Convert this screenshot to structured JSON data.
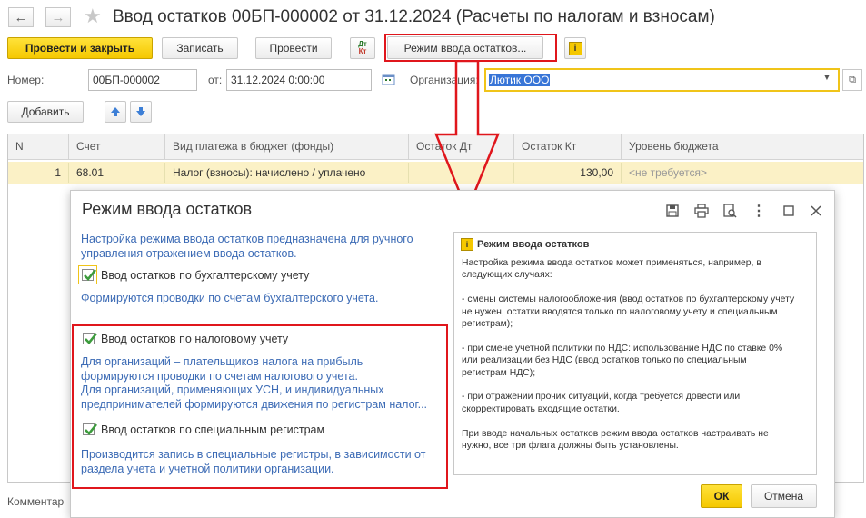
{
  "window": {
    "title": "Ввод остатков 00БП-000002 от 31.12.2024 (Расчеты по налогам и взносам)"
  },
  "toolbar": {
    "post_close_label": "Провести и закрыть",
    "write_label": "Записать",
    "post_label": "Провести",
    "dtkt_label_top": "Дт",
    "dtkt_label_bottom": "Кт",
    "mode_label": "Режим ввода остатков..."
  },
  "form": {
    "number_label": "Номер:",
    "number_value": "00БП-000002",
    "date_label": "от:",
    "date_value": "31.12.2024  0:00:00",
    "org_label": "Организация:",
    "org_value": "Лютик ООО"
  },
  "table_toolbar": {
    "add_label": "Добавить"
  },
  "table": {
    "columns": [
      "N",
      "Счет",
      "Вид платежа в бюджет (фонды)",
      "Остаток Дт",
      "Остаток Кт",
      "Уровень бюджета"
    ],
    "rows": [
      {
        "n": "1",
        "account": "68.01",
        "payment_type": "Налог (взносы): начислено / уплачено",
        "debit": "",
        "credit": "130,00",
        "budget_level": "<не требуется>"
      }
    ]
  },
  "footer": {
    "comment_label": "Комментар"
  },
  "dialog": {
    "title": "Режим ввода остатков",
    "intro": [
      "Настройка режима ввода остатков предназначена для ручного",
      "управления отражением  ввода остатков."
    ],
    "cb_accounting_label": "Ввод остатков по бухгалтерскому учету",
    "cb_accounting_desc": "Формируются проводки по счетам бухгалтерского учета.",
    "cb_tax_label": "Ввод остатков по налоговому учету",
    "cb_tax_desc": [
      "Для организаций – плательщиков налога на прибыль",
      "формируются проводки по счетам налогового учета.",
      "Для организаций, применяющих УСН, и  индивидуальных",
      "предпринимателей формируются движения по регистрам налог..."
    ],
    "cb_special_label": "Ввод остатков по специальным регистрам",
    "cb_special_desc": [
      "Производится запись в специальные регистры, в зависимости от",
      "раздела учета и учетной политики организации."
    ],
    "help": {
      "title": "Режим ввода остатков",
      "lines": [
        "Настройка режима ввода остатков может применяться, например, в",
        "следующих случаях:",
        "",
        "- смены системы налогообложения (ввод остатков по бухгалтерскому учету",
        "не нужен, остатки вводятся только по налоговому учету и специальным",
        "регистрам);",
        "",
        "- при смене учетной политики по НДС: использование НДС по ставке 0%",
        "или реализации без НДС (ввод остатков только по специальным",
        "регистрам НДС);",
        "",
        "- при отражении прочих ситуаций, когда требуется довести или",
        "скорректировать входящие остатки.",
        "",
        "При вводе начальных остатков режим ввода остатков настраивать не",
        "нужно, все три флага должны быть установлены."
      ]
    },
    "ok_label": "ОК",
    "cancel_label": "Отмена"
  },
  "state": {
    "cb_accounting_checked": true,
    "cb_tax_checked": true,
    "cb_special_checked": true
  },
  "colors": {
    "accent_yellow": "#f5c800",
    "highlight_red": "#e0161c",
    "link_blue": "#3c6bb5",
    "row_selected": "#fbf1c6"
  }
}
